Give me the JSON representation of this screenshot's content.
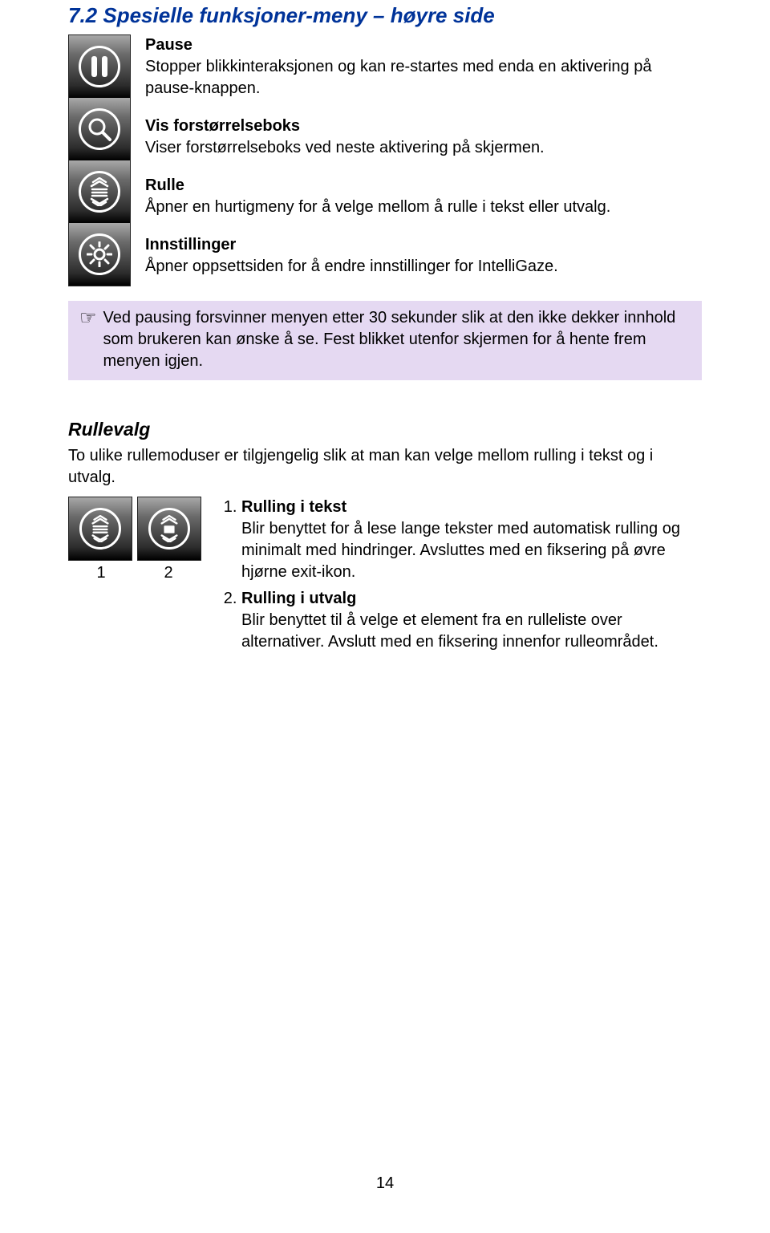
{
  "section_title": "7.2 Spesielle funksjoner-meny – høyre side",
  "menu_items": [
    {
      "title": "Pause",
      "desc": "Stopper blikkinteraksjonen og kan re-startes med enda en aktivering på pause-knappen.",
      "icon": "pause"
    },
    {
      "title": "Vis forstørrelseboks",
      "desc": "Viser forstørrelseboks ved neste aktivering på skjermen.",
      "icon": "magnifier"
    },
    {
      "title": "Rulle",
      "desc": "Åpner en hurtigmeny for å velge mellom å rulle i tekst eller utvalg.",
      "icon": "scroll-text"
    },
    {
      "title": "Innstillinger",
      "desc": "Åpner oppsettsiden for å endre innstillinger for IntelliGaze.",
      "icon": "gear"
    }
  ],
  "callout_text": "Ved pausing forsvinner menyen etter 30 sekunder slik at den ikke dekker innhold som brukeren kan ønske å se. Fest blikket utenfor skjermen for å hente frem menyen igjen.",
  "rullevalg": {
    "heading": "Rullevalg",
    "intro": "To ulike rullemoduser er tilgjengelig slik at man kan velge mellom rulling i tekst og i utvalg.",
    "icon_labels": [
      "1",
      "2"
    ],
    "items": [
      {
        "title": "Rulling i tekst",
        "desc": "Blir benyttet for å lese lange tekster med automatisk rulling og minimalt med hindringer. Avsluttes med en fiksering på øvre hjørne exit-ikon."
      },
      {
        "title": "Rulling i utvalg",
        "desc": "Blir benyttet til å velge et element fra en rulleliste over alternativer. Avslutt med en fiksering innenfor rulleområdet."
      }
    ]
  },
  "page_number": "14"
}
